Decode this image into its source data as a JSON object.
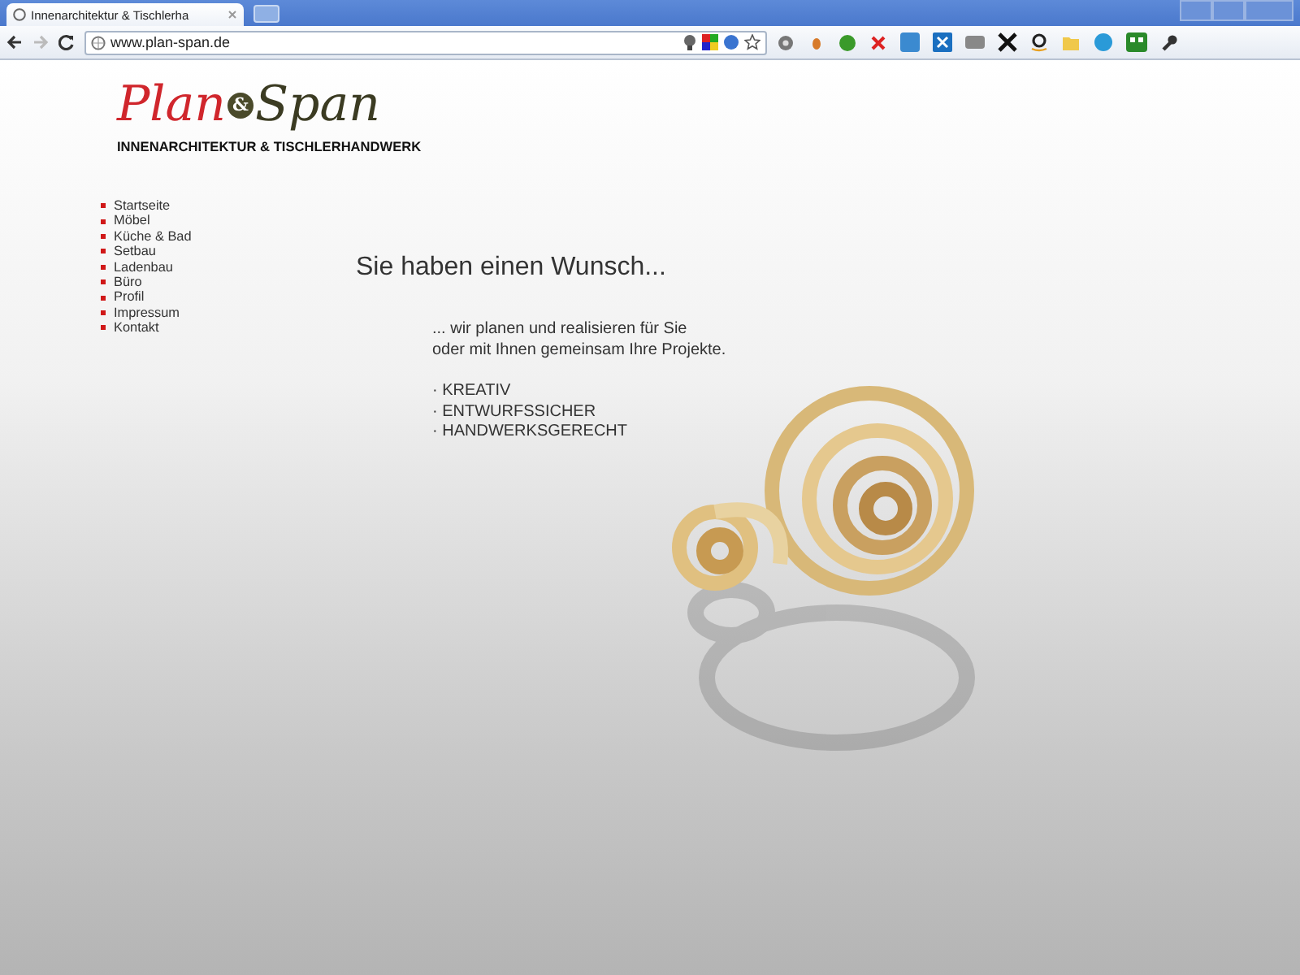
{
  "browser": {
    "tabs": [
      {
        "title": "Innenarchitektur & Tischlerha",
        "selected": true
      }
    ],
    "address": "www.plan-span.de"
  },
  "logo": {
    "part_1": "Plan",
    "part_2": "&",
    "part_3": "Span"
  },
  "tagline": "INNENARCHITEKTUR & TISCHLERHANDWERK",
  "nav": [
    "Startseite",
    "Möbel",
    "Küche & Bad",
    "Setbau",
    "Ladenbau",
    "Büro",
    "Profil",
    "Impressum",
    "Kontakt"
  ],
  "heading": "Sie haben einen Wunsch...",
  "intro": [
    "... wir planen und realisieren für Sie",
    "oder mit Ihnen gemeinsam Ihre Projekte."
  ],
  "features": [
    "· KREATIV",
    "· ENTWURFSSICHER",
    "· HANDWERKSGERECHT"
  ]
}
